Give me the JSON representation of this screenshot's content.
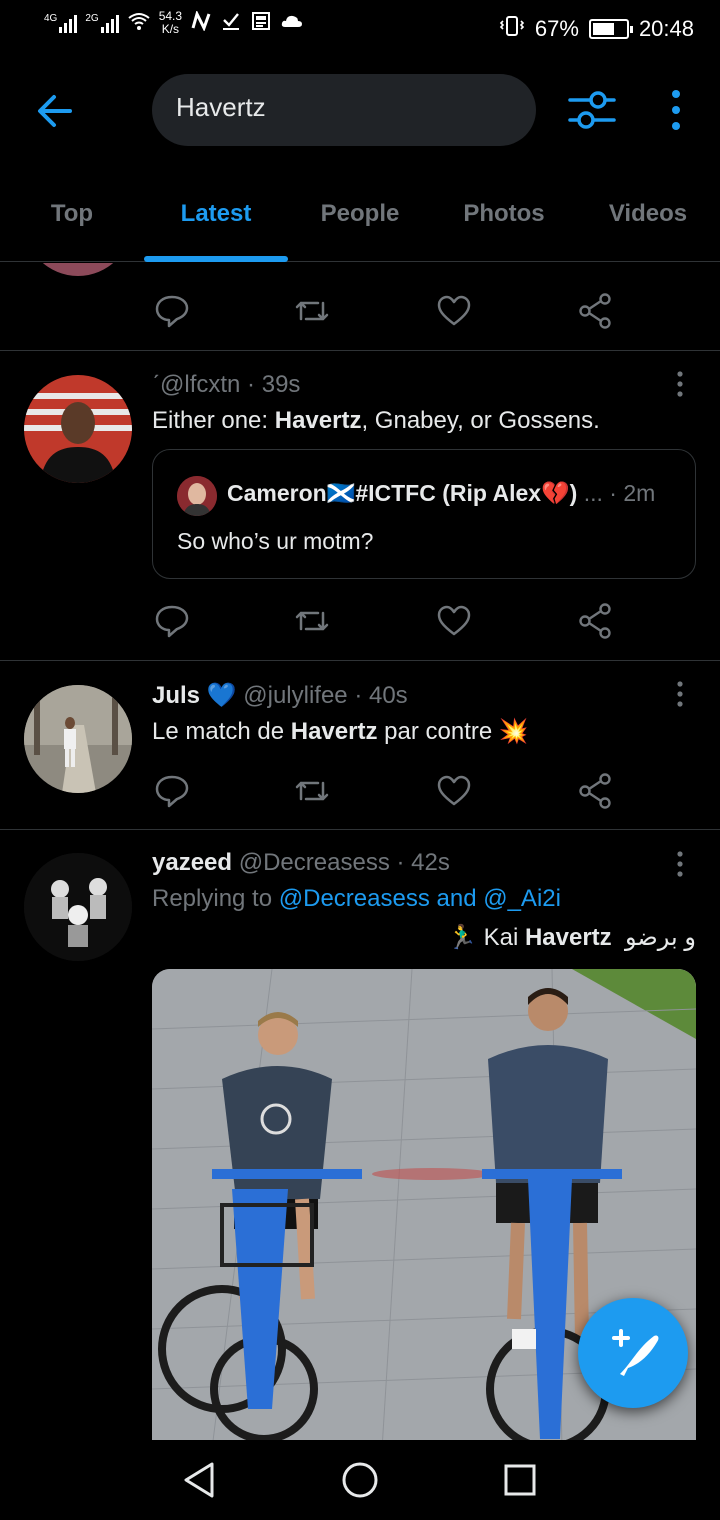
{
  "status_bar": {
    "network1": "4G",
    "network2": "2G",
    "speed_value": "54.3",
    "speed_unit": "K/s",
    "battery": "67%",
    "battery_level": 0.67,
    "time": "20:48"
  },
  "header": {
    "search_value": "Havertz"
  },
  "tabs": [
    {
      "label": "Top",
      "active": false
    },
    {
      "label": "Latest",
      "active": true
    },
    {
      "label": "People",
      "active": false
    },
    {
      "label": "Photos",
      "active": false
    },
    {
      "label": "Videos",
      "active": false
    }
  ],
  "tweets": [
    {
      "handle_prefix": "ˊ",
      "handle": "@lfcxtn",
      "time": "39s",
      "text_before": "Either one: ",
      "text_bold": "Havertz",
      "text_after": ", Gnabey, or Gossens.",
      "quote": {
        "name": "Cameron🏴󠁧󠁢󠁳󠁣󠁴󠁿#ICTFC (Rip Alex💔)",
        "ellipsis": "...",
        "time": "2m",
        "text": "So who’s ur motm?"
      }
    },
    {
      "name": "Juls 💙",
      "handle": "@julylifee",
      "time": "40s",
      "text_before": "Le match de ",
      "text_bold": "Havertz",
      "text_after": " par contre 💥"
    },
    {
      "name": "yazeed",
      "handle": "@Decreasess",
      "time": "42s",
      "reply_prefix": "Replying to ",
      "reply_link1": "@Decreasess",
      "reply_and": " and ",
      "reply_link2": "@_Ai2i",
      "rtl_arabic": "و برضو",
      "rtl_name": "Kai ",
      "rtl_bold": "Havertz",
      "rtl_emoji": "🏃‍♂️"
    }
  ],
  "icons": {
    "back": "arrow-left-icon",
    "filter": "sliders-icon",
    "more": "vertical-dots-icon",
    "reply": "speech-bubble-icon",
    "retweet": "retweet-icon",
    "like": "heart-icon",
    "share": "share-icon",
    "compose": "compose-feather-icon"
  },
  "colors": {
    "accent": "#1d9bf0",
    "background": "#000000",
    "muted": "#71767b",
    "text": "#e7e9ea"
  }
}
